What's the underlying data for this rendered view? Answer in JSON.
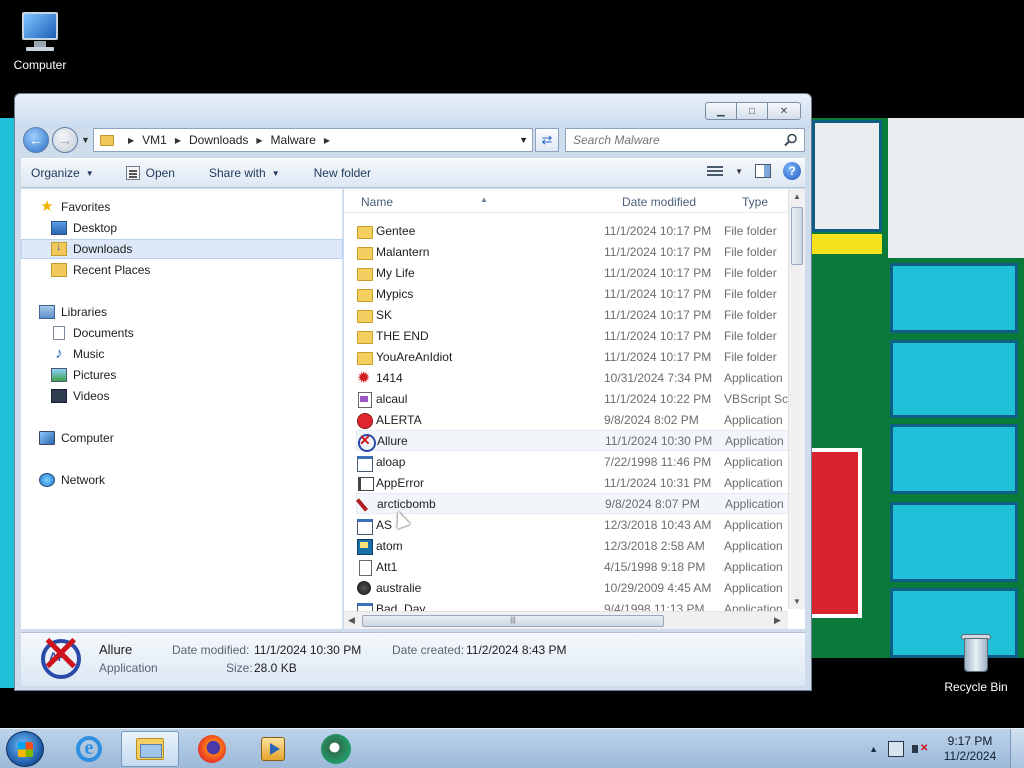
{
  "desktop": {
    "icons": [
      {
        "label": "Computer"
      },
      {
        "label": "Recycle Bin"
      }
    ]
  },
  "window": {
    "buttons": {
      "minimize": "▁",
      "maximize": "□",
      "close": "✕"
    },
    "address": {
      "crumbs": [
        "VM1",
        "Downloads",
        "Malware"
      ],
      "search_placeholder": "Search Malware"
    },
    "toolbar": {
      "organize": "Organize",
      "open": "Open",
      "share_with": "Share with",
      "new_folder": "New folder",
      "help": "?"
    },
    "nav": {
      "favorites": "Favorites",
      "desktop": "Desktop",
      "downloads": "Downloads",
      "recent_places": "Recent Places",
      "libraries": "Libraries",
      "documents": "Documents",
      "music": "Music",
      "pictures": "Pictures",
      "videos": "Videos",
      "computer": "Computer",
      "network": "Network"
    },
    "columns": {
      "name": "Name",
      "date": "Date modified",
      "type": "Type"
    },
    "files": [
      {
        "name": "Gentee",
        "date": "11/1/2024 10:17 PM",
        "type": "File folder",
        "icon": "folder-icon"
      },
      {
        "name": "Malantern",
        "date": "11/1/2024 10:17 PM",
        "type": "File folder",
        "icon": "folder-icon"
      },
      {
        "name": "My Life",
        "date": "11/1/2024 10:17 PM",
        "type": "File folder",
        "icon": "folder-icon"
      },
      {
        "name": "Mypics",
        "date": "11/1/2024 10:17 PM",
        "type": "File folder",
        "icon": "folder-icon"
      },
      {
        "name": "SK",
        "date": "11/1/2024 10:17 PM",
        "type": "File folder",
        "icon": "folder-icon"
      },
      {
        "name": "THE END",
        "date": "11/1/2024 10:17 PM",
        "type": "File folder",
        "icon": "folder-icon"
      },
      {
        "name": "YouAreAnIdiot",
        "date": "11/1/2024 10:17 PM",
        "type": "File folder",
        "icon": "folder-icon"
      },
      {
        "name": "1414",
        "date": "10/31/2024 7:34 PM",
        "type": "Application",
        "icon": "burst-icon"
      },
      {
        "name": "alcaul",
        "date": "11/1/2024 10:22 PM",
        "type": "VBScript Script File",
        "icon": "vbscript-icon"
      },
      {
        "name": "ALERTA",
        "date": "9/8/2024 8:02 PM",
        "type": "Application",
        "icon": "stop-sign-icon"
      },
      {
        "name": "Allure",
        "date": "11/1/2024 10:30 PM",
        "type": "Application",
        "icon": "no-ap-icon"
      },
      {
        "name": "aloap",
        "date": "7/22/1998 11:46 PM",
        "type": "Application",
        "icon": "app-window-icon"
      },
      {
        "name": "AppError",
        "date": "11/1/2024 10:31 PM",
        "type": "Application",
        "icon": "error-doc-icon"
      },
      {
        "name": "arcticbomb",
        "date": "9/8/2024 8:07 PM",
        "type": "Application",
        "icon": "bomb-icon"
      },
      {
        "name": "AS",
        "date": "12/3/2018 10:43 AM",
        "type": "Application",
        "icon": "app-window-icon"
      },
      {
        "name": "atom",
        "date": "12/3/2018 2:58 AM",
        "type": "Application",
        "icon": "atom-icon"
      },
      {
        "name": "Att1",
        "date": "4/15/1998 9:18 PM",
        "type": "Application",
        "icon": "doc-icon"
      },
      {
        "name": "australie",
        "date": "10/29/2009 4:45 AM",
        "type": "Application",
        "icon": "face-icon"
      },
      {
        "name": "Bad_Day",
        "date": "9/4/1998 11:13 PM",
        "type": "Application",
        "icon": "app-window-icon"
      }
    ],
    "details": {
      "name": "Allure",
      "type": "Application",
      "modified_label": "Date modified:",
      "modified_value": "11/1/2024 10:30 PM",
      "created_label": "Date created:",
      "created_value": "11/2/2024 8:43 PM",
      "size_label": "Size:",
      "size_value": "28.0 KB",
      "icon_text": "AP"
    }
  },
  "taskbar": {
    "clock_time": "9:17 PM",
    "clock_date": "11/2/2024"
  }
}
